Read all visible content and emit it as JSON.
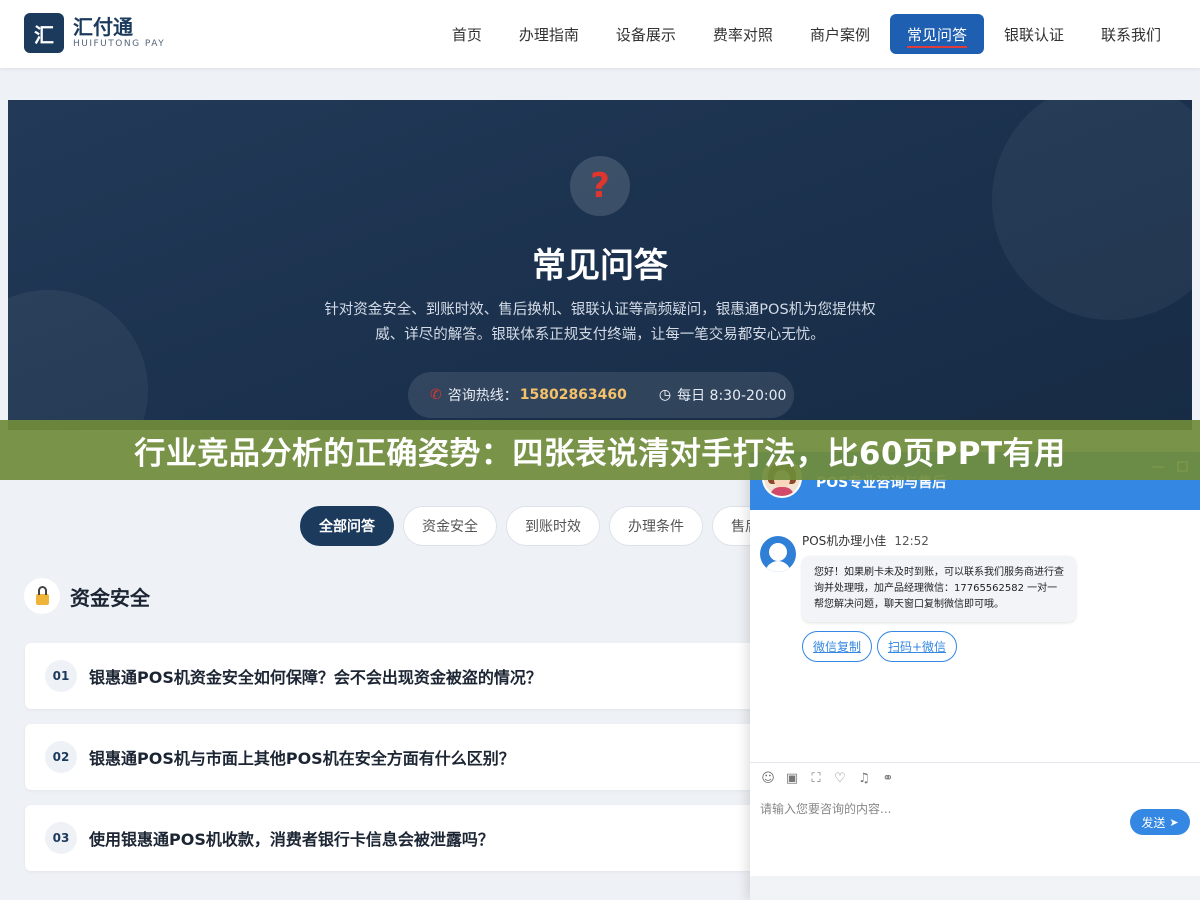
{
  "header": {
    "logo_mark": "汇",
    "logo_cn": "汇付通",
    "logo_en": "HUIFUTONG PAY",
    "nav": [
      "首页",
      "办理指南",
      "设备展示",
      "费率对照",
      "商户案例",
      "常见问答",
      "银联认证",
      "联系我们"
    ],
    "active_nav": "常见问答"
  },
  "hero": {
    "icon": "?",
    "title": "常见问答",
    "desc": "针对资金安全、到账时效、售后换机、银联认证等高频疑问，银惠通POS机为您提供权威、详尽的解答。银联体系正规支付终端，让每一笔交易都安心无忧。",
    "hotline_label": "咨询热线：",
    "hotline_number": "15802863460",
    "hours": "每日 8:30-20:00"
  },
  "banner": {
    "text": "行业竞品分析的正确姿势：四张表说清对手打法，比60页PPT有用"
  },
  "tabs": [
    "全部问答",
    "资金安全",
    "到账时效",
    "办理条件",
    "售后"
  ],
  "section": {
    "title": "资金安全",
    "faqs": [
      {
        "num": "01",
        "question": "银惠通POS机资金安全如何保障？会不会出现资金被盗的情况？"
      },
      {
        "num": "02",
        "question": "银惠通POS机与市面上其他POS机在安全方面有什么区别？"
      },
      {
        "num": "03",
        "question": "使用银惠通POS机收款，消费者银行卡信息会被泄露吗？"
      }
    ]
  },
  "chat": {
    "title": "POS专业咨询与售后",
    "agent_name": "POS机办理小佳",
    "time": "12:52",
    "message": "您好！如果刷卡未及时到账，可以联系我们服务商进行查询并处理哦，加产品经理微信：17765562582 一对一帮您解决问题，聊天窗口复制微信即可哦。",
    "quick_replies": [
      "微信复制",
      "扫码+微信"
    ],
    "input_placeholder": "请输入您要咨询的内容...",
    "send_label": "发送"
  },
  "colors": {
    "brand": "#1b3a5c",
    "nav_active": "#1f5fb2",
    "chat_accent": "#3487e2",
    "banner": "#6f8c3a",
    "hotline": "#f5c26a"
  }
}
